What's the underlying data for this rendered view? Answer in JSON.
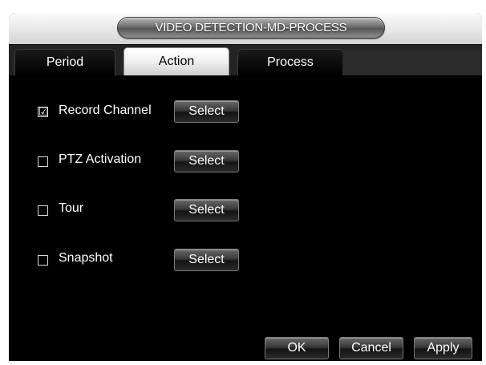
{
  "window": {
    "title": "VIDEO DETECTION-MD-PROCESS"
  },
  "tabs": [
    {
      "label": "Period",
      "active": false
    },
    {
      "label": "Action",
      "active": true
    },
    {
      "label": "Process",
      "active": false
    }
  ],
  "actions": [
    {
      "label": "Record Channel",
      "checked": true,
      "check_glyph": "☑",
      "button": "Select"
    },
    {
      "label": "PTZ Activation",
      "checked": false,
      "button": "Select"
    },
    {
      "label": "Tour",
      "checked": false,
      "button": "Select"
    },
    {
      "label": "Snapshot",
      "checked": false,
      "button": "Select"
    }
  ],
  "footer": {
    "ok": "OK",
    "cancel": "Cancel",
    "apply": "Apply"
  },
  "colors": {
    "background": "#000000",
    "text": "#ffffff",
    "titlebar": "#e6e6e6",
    "active_tab": "#efefef"
  }
}
